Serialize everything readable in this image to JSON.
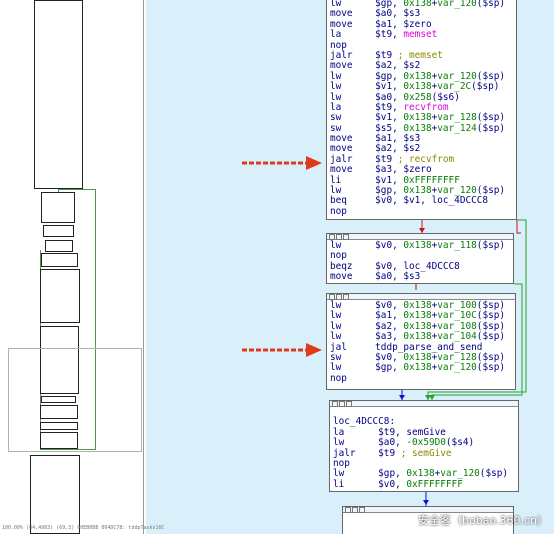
{
  "status_text": "100.00% (84,4983) (69,3) 00EB0BB 004DC78: tddpTasks10C",
  "watermark": "安全客（bobao.360.cn）",
  "colors": {
    "green_edge": "#2aa02a",
    "red_edge": "#d01010",
    "blue_edge": "#1010d0",
    "graph_bg": "#d9f0fb",
    "arrow": "#e03a1a"
  },
  "overview": {
    "label": "graph-overview"
  },
  "blocks": [
    {
      "id": "block1",
      "lines": [
        [
          [
            "lw      ",
            "k"
          ],
          [
            "$gp, ",
            "k"
          ],
          [
            "0x138",
            "c"
          ],
          [
            "+",
            "k"
          ],
          [
            "var_120",
            "c"
          ],
          [
            "($sp)",
            "k"
          ]
        ],
        [
          [
            "move    ",
            "k"
          ],
          [
            "$a0, $s3",
            "k"
          ]
        ],
        [
          [
            "move    ",
            "k"
          ],
          [
            "$a1, $zero",
            "k"
          ]
        ],
        [
          [
            "la      ",
            "k"
          ],
          [
            "$t9, ",
            "k"
          ],
          [
            "memset",
            "p"
          ]
        ],
        [
          [
            "nop",
            "k"
          ]
        ],
        [
          [
            "jalr    ",
            "k"
          ],
          [
            "$t9 ",
            "k"
          ],
          [
            "; memset",
            "m"
          ]
        ],
        [
          [
            "move    ",
            "k"
          ],
          [
            "$a2, $s2",
            "k"
          ]
        ],
        [
          [
            "lw      ",
            "k"
          ],
          [
            "$gp, ",
            "k"
          ],
          [
            "0x138",
            "c"
          ],
          [
            "+",
            "k"
          ],
          [
            "var_120",
            "c"
          ],
          [
            "($sp)",
            "k"
          ]
        ],
        [
          [
            "lw      ",
            "k"
          ],
          [
            "$v1, ",
            "k"
          ],
          [
            "0x138",
            "c"
          ],
          [
            "+",
            "k"
          ],
          [
            "var_2C",
            "c"
          ],
          [
            "($sp)",
            "k"
          ]
        ],
        [
          [
            "lw      ",
            "k"
          ],
          [
            "$a0, ",
            "k"
          ],
          [
            "0x258",
            "c"
          ],
          [
            "($s6)",
            "k"
          ]
        ],
        [
          [
            "la      ",
            "k"
          ],
          [
            "$t9, ",
            "k"
          ],
          [
            "recvfrom",
            "p"
          ]
        ],
        [
          [
            "sw      ",
            "k"
          ],
          [
            "$v1, ",
            "k"
          ],
          [
            "0x138",
            "c"
          ],
          [
            "+",
            "k"
          ],
          [
            "var_128",
            "c"
          ],
          [
            "($sp)",
            "k"
          ]
        ],
        [
          [
            "sw      ",
            "k"
          ],
          [
            "$s5, ",
            "k"
          ],
          [
            "0x138",
            "c"
          ],
          [
            "+",
            "k"
          ],
          [
            "var_124",
            "c"
          ],
          [
            "($sp)",
            "k"
          ]
        ],
        [
          [
            "move    ",
            "k"
          ],
          [
            "$a1, $s3",
            "k"
          ]
        ],
        [
          [
            "move    ",
            "k"
          ],
          [
            "$a2, $s2",
            "k"
          ]
        ],
        [
          [
            "jalr    ",
            "k"
          ],
          [
            "$t9 ",
            "k"
          ],
          [
            "; recvfrom",
            "m"
          ]
        ],
        [
          [
            "move    ",
            "k"
          ],
          [
            "$a3, $zero",
            "k"
          ]
        ],
        [
          [
            "li      ",
            "k"
          ],
          [
            "$v1, ",
            "k"
          ],
          [
            "0xFFFFFFFF",
            "c"
          ]
        ],
        [
          [
            "lw      ",
            "k"
          ],
          [
            "$gp, ",
            "k"
          ],
          [
            "0x138",
            "c"
          ],
          [
            "+",
            "k"
          ],
          [
            "var_120",
            "c"
          ],
          [
            "($sp)",
            "k"
          ]
        ],
        [
          [
            "beq     ",
            "k"
          ],
          [
            "$v0, $v1, loc_4DCCC8",
            "k"
          ]
        ],
        [
          [
            "nop",
            "k"
          ]
        ]
      ]
    },
    {
      "id": "block2",
      "lines": [
        [
          [
            "lw      ",
            "k"
          ],
          [
            "$v0, ",
            "k"
          ],
          [
            "0x138",
            "c"
          ],
          [
            "+",
            "k"
          ],
          [
            "var_118",
            "c"
          ],
          [
            "($sp)",
            "k"
          ]
        ],
        [
          [
            "nop",
            "k"
          ]
        ],
        [
          [
            "beqz    ",
            "k"
          ],
          [
            "$v0, loc_4DCCC8",
            "k"
          ]
        ],
        [
          [
            "move    ",
            "k"
          ],
          [
            "$a0, $s3",
            "k"
          ]
        ]
      ]
    },
    {
      "id": "block3",
      "lines": [
        [
          [
            "lw      ",
            "k"
          ],
          [
            "$v0, ",
            "k"
          ],
          [
            "0x138",
            "c"
          ],
          [
            "+",
            "k"
          ],
          [
            "var_100",
            "c"
          ],
          [
            "($sp)",
            "k"
          ]
        ],
        [
          [
            "lw      ",
            "k"
          ],
          [
            "$a1, ",
            "k"
          ],
          [
            "0x138",
            "c"
          ],
          [
            "+",
            "k"
          ],
          [
            "var_10C",
            "c"
          ],
          [
            "($sp)",
            "k"
          ]
        ],
        [
          [
            "lw      ",
            "k"
          ],
          [
            "$a2, ",
            "k"
          ],
          [
            "0x138",
            "c"
          ],
          [
            "+",
            "k"
          ],
          [
            "var_108",
            "c"
          ],
          [
            "($sp)",
            "k"
          ]
        ],
        [
          [
            "lw      ",
            "k"
          ],
          [
            "$a3, ",
            "k"
          ],
          [
            "0x138",
            "c"
          ],
          [
            "+",
            "k"
          ],
          [
            "var_104",
            "c"
          ],
          [
            "($sp)",
            "k"
          ]
        ],
        [
          [
            "jal     ",
            "k"
          ],
          [
            "tddp_parse_and_send",
            "k"
          ]
        ],
        [
          [
            "sw      ",
            "k"
          ],
          [
            "$v0, ",
            "k"
          ],
          [
            "0x138",
            "c"
          ],
          [
            "+",
            "k"
          ],
          [
            "var_128",
            "c"
          ],
          [
            "($sp)",
            "k"
          ]
        ],
        [
          [
            "lw      ",
            "k"
          ],
          [
            "$gp, ",
            "k"
          ],
          [
            "0x138",
            "c"
          ],
          [
            "+",
            "k"
          ],
          [
            "var_120",
            "c"
          ],
          [
            "($sp)",
            "k"
          ]
        ],
        [
          [
            "nop",
            "k"
          ]
        ]
      ]
    },
    {
      "id": "block4",
      "lines": [
        [
          [
            "",
            "k"
          ]
        ],
        [
          [
            "loc_4DCCC8:",
            "k"
          ]
        ],
        [
          [
            "la      ",
            "k"
          ],
          [
            "$t9, ",
            "k"
          ],
          [
            "semGive",
            "k"
          ]
        ],
        [
          [
            "lw      ",
            "k"
          ],
          [
            "$a0, ",
            "k"
          ],
          [
            "-0x59D0",
            "c"
          ],
          [
            "($s4)",
            "k"
          ]
        ],
        [
          [
            "jalr    ",
            "k"
          ],
          [
            "$t9 ",
            "k"
          ],
          [
            "; semGive",
            "m"
          ]
        ],
        [
          [
            "nop",
            "k"
          ]
        ],
        [
          [
            "lw      ",
            "k"
          ],
          [
            "$gp, ",
            "k"
          ],
          [
            "0x138",
            "c"
          ],
          [
            "+",
            "k"
          ],
          [
            "var_120",
            "c"
          ],
          [
            "($sp)",
            "k"
          ]
        ],
        [
          [
            "li      ",
            "k"
          ],
          [
            "$v0, ",
            "k"
          ],
          [
            "0xFFFFFFFF",
            "c"
          ]
        ]
      ]
    }
  ]
}
